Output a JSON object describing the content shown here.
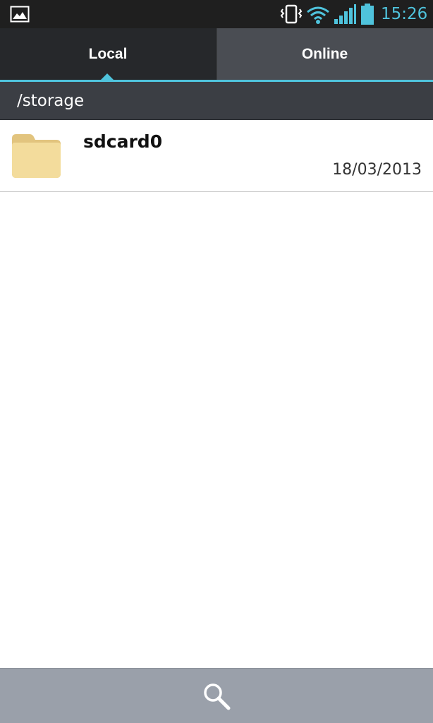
{
  "status_bar": {
    "time": "15:26",
    "accent_color": "#4fc3dc",
    "icons": [
      "gallery-icon",
      "vibrate-icon",
      "wifi-icon",
      "signal-icon",
      "battery-icon"
    ]
  },
  "tabs": [
    {
      "label": "Local",
      "selected": true
    },
    {
      "label": "Online",
      "selected": false
    }
  ],
  "path": "/storage",
  "files": [
    {
      "name": "sdcard0",
      "date": "18/03/2013",
      "icon": "folder-icon"
    }
  ],
  "bottom_bar": {
    "icon": "search-icon"
  }
}
